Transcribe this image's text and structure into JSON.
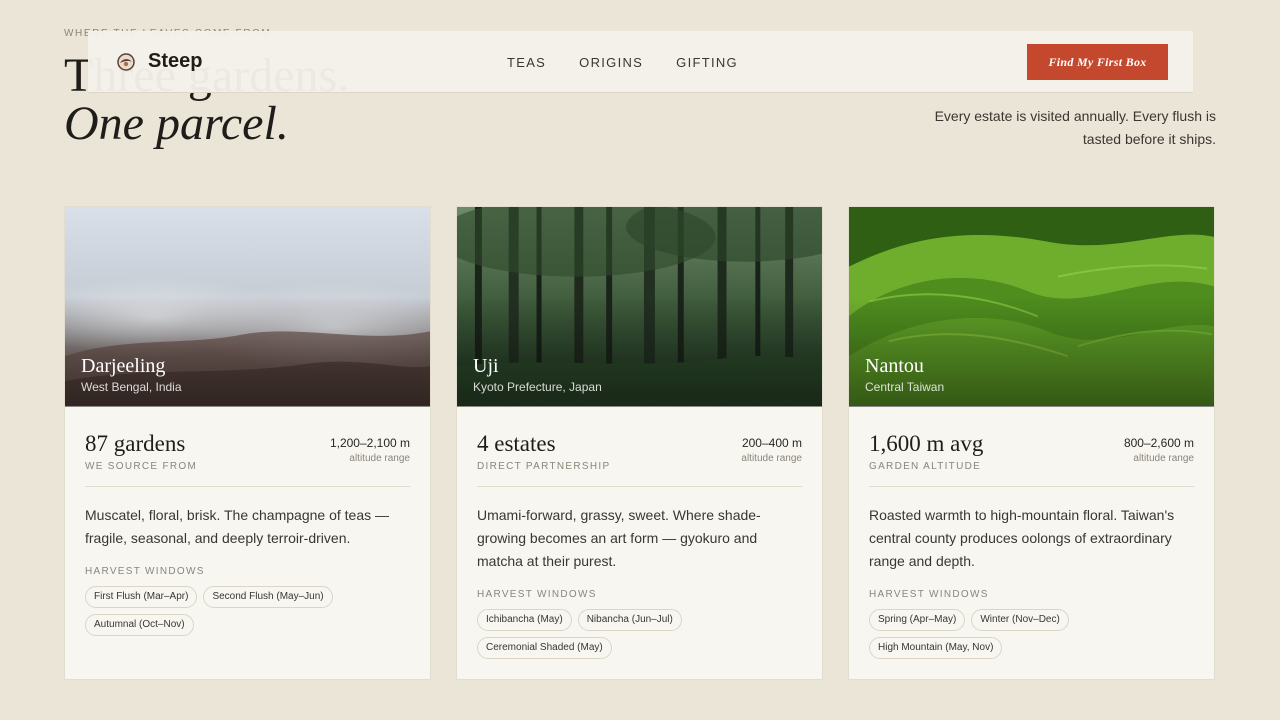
{
  "hero": {
    "eyebrow": "WHERE THE LEAVES COME FROM",
    "title_line1": "Three gardens.",
    "title_line2": "One parcel.",
    "subtitle": "Every estate is visited annually. Every flush is tasted before it ships."
  },
  "nav": {
    "brand": "Steep",
    "links": [
      "TEAS",
      "ORIGINS",
      "GIFTING"
    ],
    "cta": "Find My First Box"
  },
  "harvest_heading": "HARVEST WINDOWS",
  "altitude_caption": "altitude range",
  "cards": [
    {
      "name": "Darjeeling",
      "region": "West Bengal, India",
      "stat": "87 gardens",
      "stat_label": "WE SOURCE FROM",
      "altitude": "1,200–2,100 m",
      "description": "Muscatel, floral, brisk. The champagne of teas — fragile, seasonal, and deeply terroir-driven.",
      "harvests": [
        "First Flush (Mar–Apr)",
        "Second Flush (May–Jun)",
        "Autumnal (Oct–Nov)"
      ]
    },
    {
      "name": "Uji",
      "region": "Kyoto Prefecture, Japan",
      "stat": "4 estates",
      "stat_label": "DIRECT PARTNERSHIP",
      "altitude": "200–400 m",
      "description": "Umami-forward, grassy, sweet. Where shade-growing becomes an art form — gyokuro and matcha at their purest.",
      "harvests": [
        "Ichibancha (May)",
        "Nibancha (Jun–Jul)",
        "Ceremonial Shaded (May)"
      ]
    },
    {
      "name": "Nantou",
      "region": "Central Taiwan",
      "stat": "1,600 m avg",
      "stat_label": "GARDEN ALTITUDE",
      "altitude": "800–2,600 m",
      "description": "Roasted warmth to high-mountain floral. Taiwan's central county produces oolongs of extraordinary range and depth.",
      "harvests": [
        "Spring (Apr–May)",
        "Winter (Nov–Dec)",
        "High Mountain (May, Nov)"
      ]
    }
  ],
  "colors": {
    "background": "#ebe5d7",
    "accent": "#c4482e",
    "card": "#f8f6f1"
  }
}
